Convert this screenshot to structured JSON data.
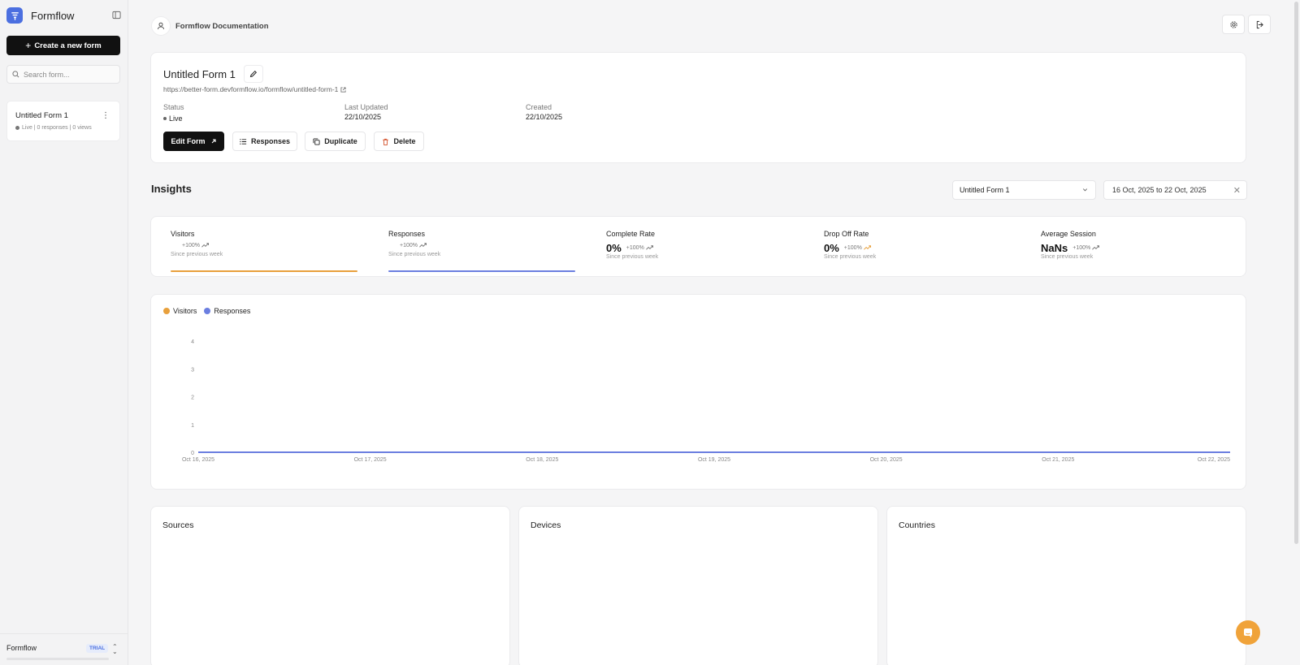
{
  "sidebar": {
    "brand": "Formflow",
    "create_label": "Create a new form",
    "search_placeholder": "Search form...",
    "forms": [
      {
        "title": "Untitled Form 1",
        "meta": "Live | 0 responses | 0 views"
      }
    ],
    "footer": {
      "workspace": "Formflow",
      "plan_badge": "TRIAL"
    }
  },
  "topbar": {
    "title": "Formflow Documentation"
  },
  "form": {
    "title": "Untitled Form 1",
    "url": "https://better-form.devformflow.io/formflow/untitled-form-1",
    "status_label": "Status",
    "status_value": "Live",
    "updated_label": "Last Updated",
    "updated_value": "22/10/2025",
    "created_label": "Created",
    "created_value": "22/10/2025",
    "actions": {
      "edit": "Edit Form",
      "responses": "Responses",
      "duplicate": "Duplicate",
      "delete": "Delete"
    }
  },
  "insights": {
    "title": "Insights",
    "form_select": "Untitled Form 1",
    "date_range": "16 Oct, 2025 to 22 Oct, 2025",
    "stats": [
      {
        "label": "Visitors",
        "value": "",
        "change": "+100%",
        "since": "Since previous week"
      },
      {
        "label": "Responses",
        "value": "",
        "change": "+100%",
        "since": "Since previous week"
      },
      {
        "label": "Complete Rate",
        "value": "0%",
        "change": "+100%",
        "since": "Since previous week"
      },
      {
        "label": "Drop Off Rate",
        "value": "0%",
        "change": "+100%",
        "since": "Since previous week"
      },
      {
        "label": "Average Session",
        "value": "NaNs",
        "change": "+100%",
        "since": "Since previous week"
      }
    ]
  },
  "colors": {
    "visitors": "#e8a03c",
    "responses": "#6b7ee0",
    "brand": "#4b6fe0",
    "fab": "#f0a33a"
  },
  "chart_data": {
    "type": "line",
    "x": [
      "Oct 16, 2025",
      "Oct 17, 2025",
      "Oct 18, 2025",
      "Oct 19, 2025",
      "Oct 20, 2025",
      "Oct 21, 2025",
      "Oct 22, 2025"
    ],
    "series": [
      {
        "name": "Visitors",
        "values": [
          0,
          0,
          0,
          0,
          0,
          0,
          0
        ]
      },
      {
        "name": "Responses",
        "values": [
          0,
          0,
          0,
          0,
          0,
          0,
          0
        ]
      }
    ],
    "yticks": [
      0,
      1,
      2,
      3,
      4
    ],
    "ylim": [
      0,
      4
    ],
    "grid": false,
    "legend": "top-left"
  },
  "panels": {
    "sources": "Sources",
    "devices": "Devices",
    "countries": "Countries"
  }
}
